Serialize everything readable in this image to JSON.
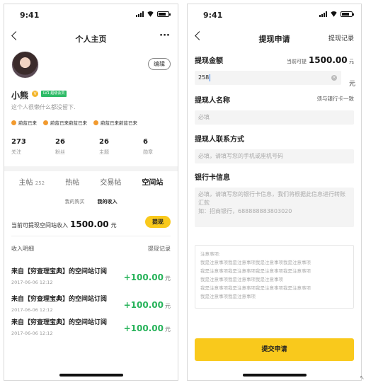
{
  "status": {
    "time": "9:41"
  },
  "profile": {
    "nav_title": "个人主页",
    "more": "···",
    "edit_label": "编辑",
    "name": "小熊",
    "verified_mark": "V",
    "level_badge": "LV1 超级会员",
    "bio": "这个人很懒什么都没留下.",
    "tags": [
      "蔚蓝已来",
      "蔚蓝已来蔚蓝已来",
      "蔚蓝已来蔚蓝已来"
    ],
    "stats": [
      {
        "value": "273",
        "label": "关注"
      },
      {
        "value": "26",
        "label": "粉丝"
      },
      {
        "value": "26",
        "label": "主题"
      },
      {
        "value": "6",
        "label": "勋章"
      }
    ],
    "tabs": [
      {
        "label": "主帖",
        "count": "252"
      },
      {
        "label": "热帖",
        "count": ""
      },
      {
        "label": "交易帖",
        "count": ""
      },
      {
        "label": "空间站",
        "count": ""
      }
    ],
    "active_tab": "空间站",
    "subtabs": [
      "我的购买",
      "我的收入"
    ],
    "income_label": "当前可提现空间站收入",
    "income_amount": "1500.00",
    "income_unit": "元",
    "withdraw_label": "提现",
    "detail_title": "收入明细",
    "detail_link": "提现记录",
    "records": [
      {
        "title": "来自【穷查理宝典】的空间站订阅",
        "date": "2017-06-06 12:12",
        "amount": "+100.00",
        "unit": "元"
      },
      {
        "title": "来自【穷查理宝典】的空间站订阅",
        "date": "2017-06-06 12:12",
        "amount": "+100.00",
        "unit": "元"
      },
      {
        "title": "来自【穷查理宝典】的空间站订阅",
        "date": "2017-06-06 12:12",
        "amount": "+100.00",
        "unit": "元"
      }
    ],
    "accent_color": "#f9c91c",
    "positive_color": "#27b35a"
  },
  "withdraw": {
    "nav_title": "提现申请",
    "nav_right": "提现记录",
    "amount_label": "提现金额",
    "available_label": "当前可提",
    "available_amount": "1500.00",
    "available_unit": "元",
    "amount_value": "258",
    "amount_unit": "元",
    "name_label": "提现人名称",
    "name_hint": "须与银行卡一致",
    "name_placeholder": "必填",
    "contact_label": "提现人联系方式",
    "contact_placeholder": "必填，请填写您的手机或座机号码",
    "bank_label": "银行卡信息",
    "bank_placeholder": "必填，请填写您的银行卡信息，我们将根据此信息进行转账汇款\n如：招商银行，688888883803020",
    "notes_title": "注意事项:",
    "notes_lines": [
      "我是注意事项我是注意事项我是注意事项我是注意事项",
      "我是注意事项我是注意事项我是注意事项我是注意事项",
      "我是注意事项我是注意事项我是注意事项",
      "我是注意事项我是注意事项我是注意事项我是注意事项",
      "我是注意事项我是注意事项"
    ],
    "submit_label": "提交申请"
  }
}
